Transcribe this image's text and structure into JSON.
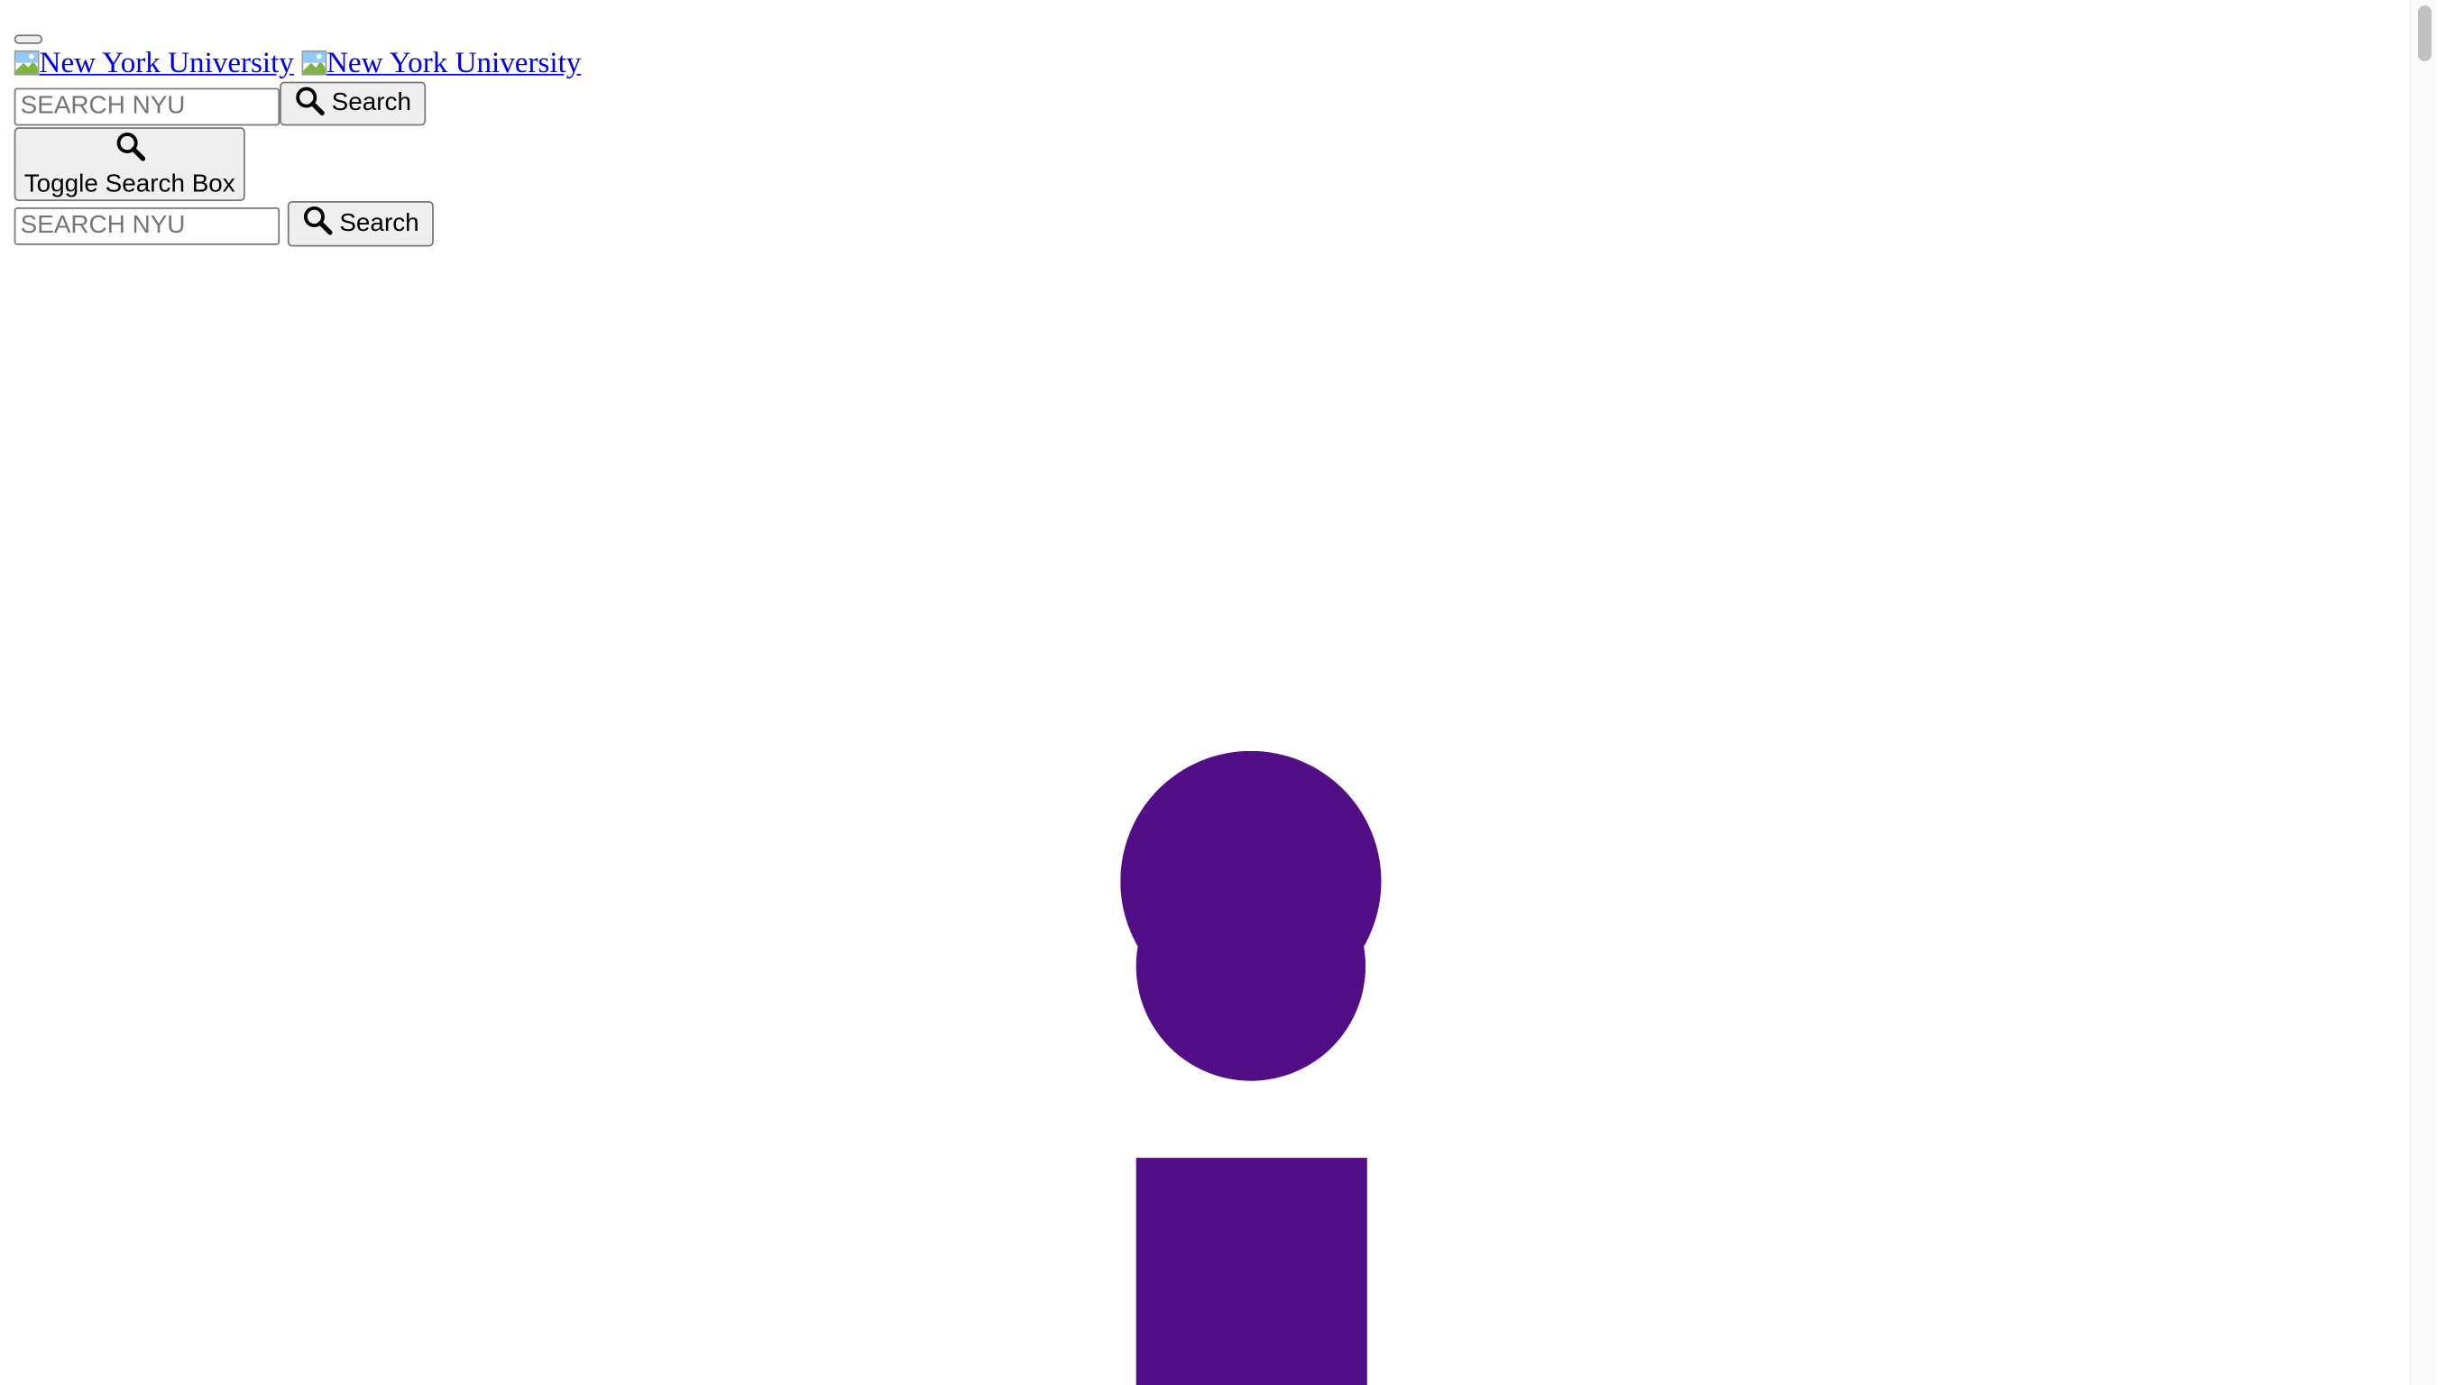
{
  "header": {
    "menu_button_label": "",
    "logo_alt_1": "New York University",
    "logo_alt_2": "New York University"
  },
  "search_primary": {
    "placeholder": "SEARCH NYU",
    "button_label": "Search"
  },
  "toggle": {
    "label": "Toggle Search Box"
  },
  "search_secondary": {
    "placeholder": "SEARCH NYU",
    "button_label": "Search"
  },
  "brand": {
    "accent_color": "#57068c",
    "link_color": "#0000ee"
  },
  "icons": [
    "search-icon",
    "broken-image-icon",
    "nyu-torch-logo"
  ]
}
